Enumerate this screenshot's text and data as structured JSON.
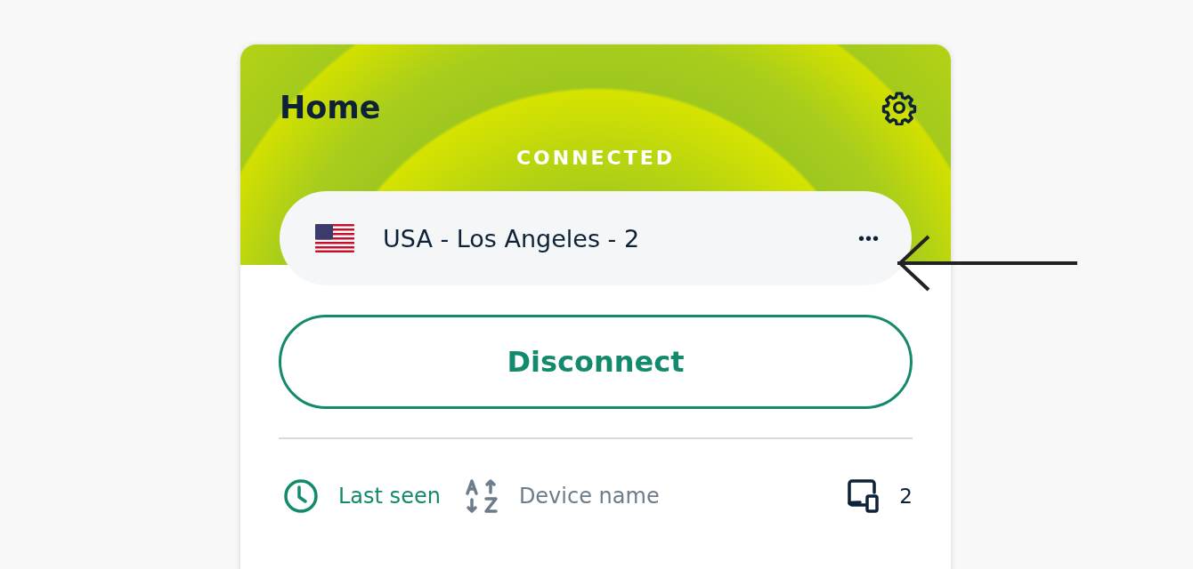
{
  "header": {
    "title": "Home",
    "status": "CONNECTED"
  },
  "location": {
    "name": "USA - Los Angeles - 2",
    "more": "•••"
  },
  "action_button": "Disconnect",
  "sort_options": [
    {
      "label": "Last seen",
      "kind": "time",
      "selected": true
    },
    {
      "label": "Device name",
      "kind": "alpha",
      "selected": false
    }
  ],
  "device_count": "2"
}
